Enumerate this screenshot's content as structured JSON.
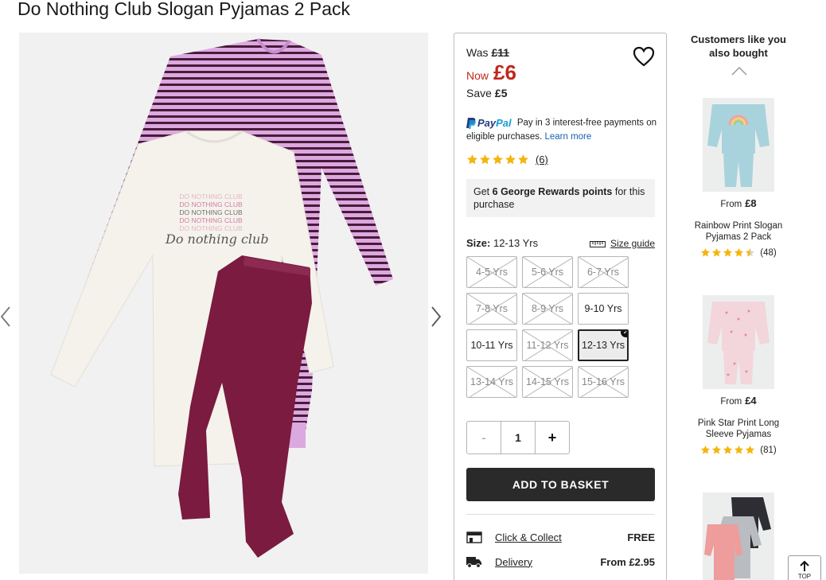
{
  "product": {
    "title": "Do Nothing Club Slogan Pyjamas 2 Pack",
    "print_lines": [
      "DO NOTHING CLUB",
      "DO NOTHING CLUB",
      "DO NOTHING CLUB",
      "DO NOTHING CLUB",
      "DO NOTHING CLUB"
    ],
    "script_text": "Do nothing club"
  },
  "price": {
    "was_label": "Was",
    "was_value": "£11",
    "now_label": "Now",
    "now_value": "£6",
    "save_label": "Save",
    "save_value": "£5"
  },
  "paypal": {
    "logo_pay": "Pay",
    "logo_pal": "Pal",
    "text": "Pay in 3 interest-free payments on eligible purchases.",
    "link": "Learn more"
  },
  "rating": {
    "stars": 5,
    "count": "(6)"
  },
  "rewards": {
    "prefix": "Get",
    "points": "6 George Rewards points",
    "suffix": "for this purchase"
  },
  "size": {
    "label": "Size:",
    "selected": "12-13 Yrs",
    "guide": "Size guide",
    "options": [
      {
        "label": "4-5 Yrs",
        "available": false
      },
      {
        "label": "5-6 Yrs",
        "available": false
      },
      {
        "label": "6-7 Yrs",
        "available": false
      },
      {
        "label": "7-8 Yrs",
        "available": false
      },
      {
        "label": "8-9 Yrs",
        "available": false
      },
      {
        "label": "9-10 Yrs",
        "available": true
      },
      {
        "label": "10-11 Yrs",
        "available": true
      },
      {
        "label": "11-12 Yrs",
        "available": false
      },
      {
        "label": "12-13 Yrs",
        "available": true
      },
      {
        "label": "13-14 Yrs",
        "available": false
      },
      {
        "label": "14-15 Yrs",
        "available": false
      },
      {
        "label": "15-16 Yrs",
        "available": false
      }
    ]
  },
  "quantity": {
    "minus": "-",
    "value": "1",
    "plus": "+"
  },
  "basket": {
    "label": "ADD TO BASKET"
  },
  "delivery": [
    {
      "icon": "store-icon",
      "name": "Click & Collect",
      "price": "FREE"
    },
    {
      "icon": "truck-icon",
      "name": "Delivery",
      "price": "From £2.95"
    }
  ],
  "recommendations": {
    "title": "Customers like you also bought",
    "items": [
      {
        "from_label": "From",
        "price": "£8",
        "name": "Rainbow Print Slogan Pyjamas 2 Pack",
        "rating": 4.5,
        "count": "(48)"
      },
      {
        "from_label": "From",
        "price": "£4",
        "name": "Pink Star Print Long Sleeve Pyjamas",
        "rating": 5,
        "count": "(81)"
      },
      {
        "from_label": "",
        "price": "",
        "name": "",
        "rating": 0,
        "count": ""
      }
    ]
  },
  "back_to_top": {
    "label": "TOP"
  },
  "colors": {
    "sale_red": "#c1271c",
    "button_dark": "#2a2a2a",
    "star_gold": "#f5b50f",
    "stripe_purple": "#4a1a3a",
    "stripe_pink": "#d9a7dc",
    "trouser_plum": "#7a1b3f",
    "top_cream": "#f4f1ec"
  }
}
